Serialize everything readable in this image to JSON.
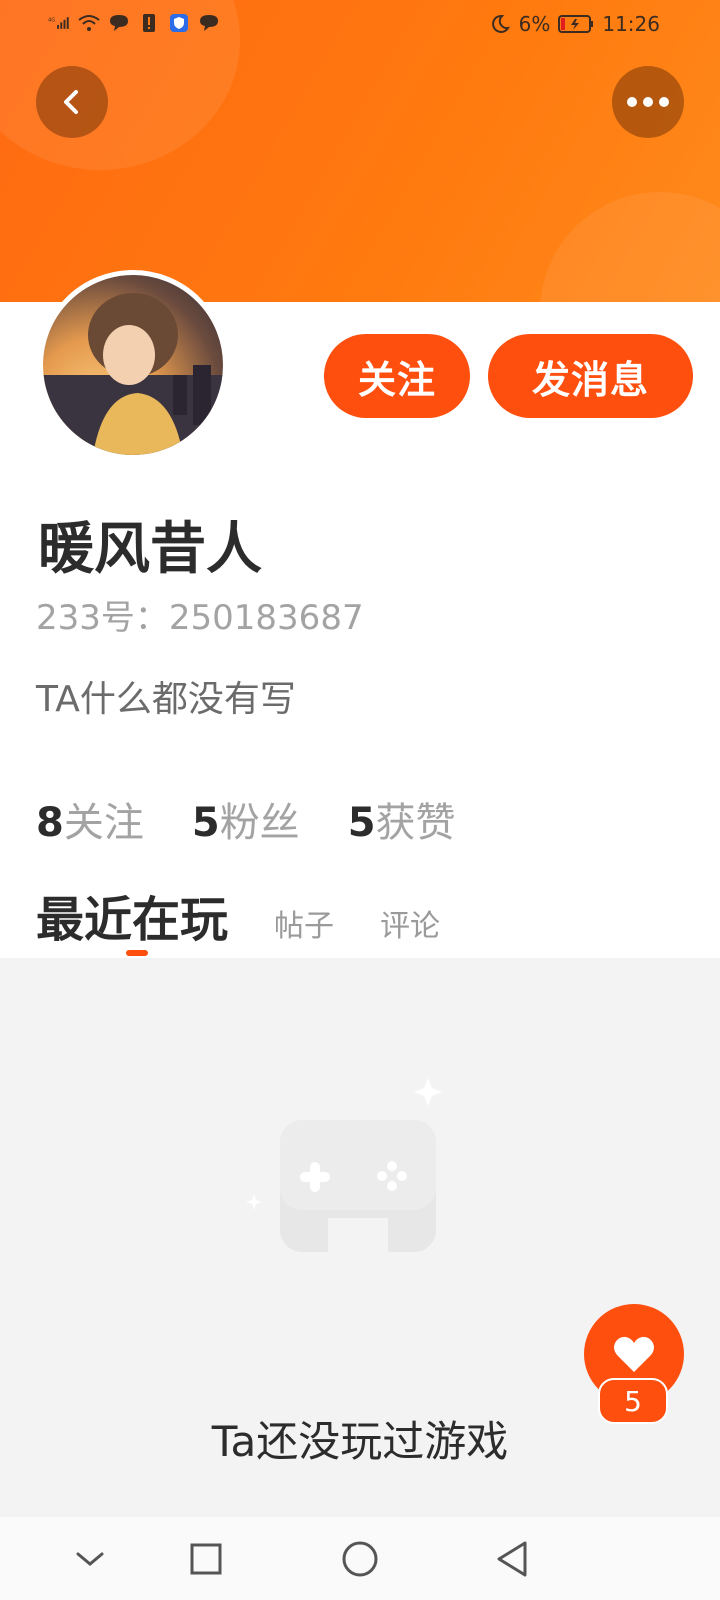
{
  "status_bar": {
    "network": "4G",
    "battery_percent": "6%",
    "time": "11:26"
  },
  "header": {
    "back_icon": "back-arrow-icon",
    "more_icon": "more-dots-icon"
  },
  "profile": {
    "avatar_icon": "user-avatar",
    "follow_label": "关注",
    "message_label": "发消息",
    "username": "暖风昔人",
    "uid_text": "233号：250183687",
    "bio": "TA什么都没有写",
    "stats": [
      {
        "num": "8",
        "label": "关注"
      },
      {
        "num": "5",
        "label": "粉丝"
      },
      {
        "num": "5",
        "label": "获赞"
      }
    ]
  },
  "tabs": [
    {
      "label": "最近在玩",
      "active": true
    },
    {
      "label": "帖子",
      "active": false
    },
    {
      "label": "评论",
      "active": false
    }
  ],
  "empty_state": {
    "illustration_icon": "gamepad-icon",
    "text": "Ta还没玩过游戏"
  },
  "like_fab": {
    "icon": "heart-icon",
    "count": "5"
  },
  "nav_bar": {
    "icons": [
      "chevron-down-icon",
      "square-icon",
      "circle-icon",
      "triangle-back-icon"
    ]
  },
  "colors": {
    "accent": "#ff4f0f",
    "header_orange": "#ff7a0f",
    "text_dark": "#2c2c2c",
    "text_grey": "#a3a3a3"
  }
}
